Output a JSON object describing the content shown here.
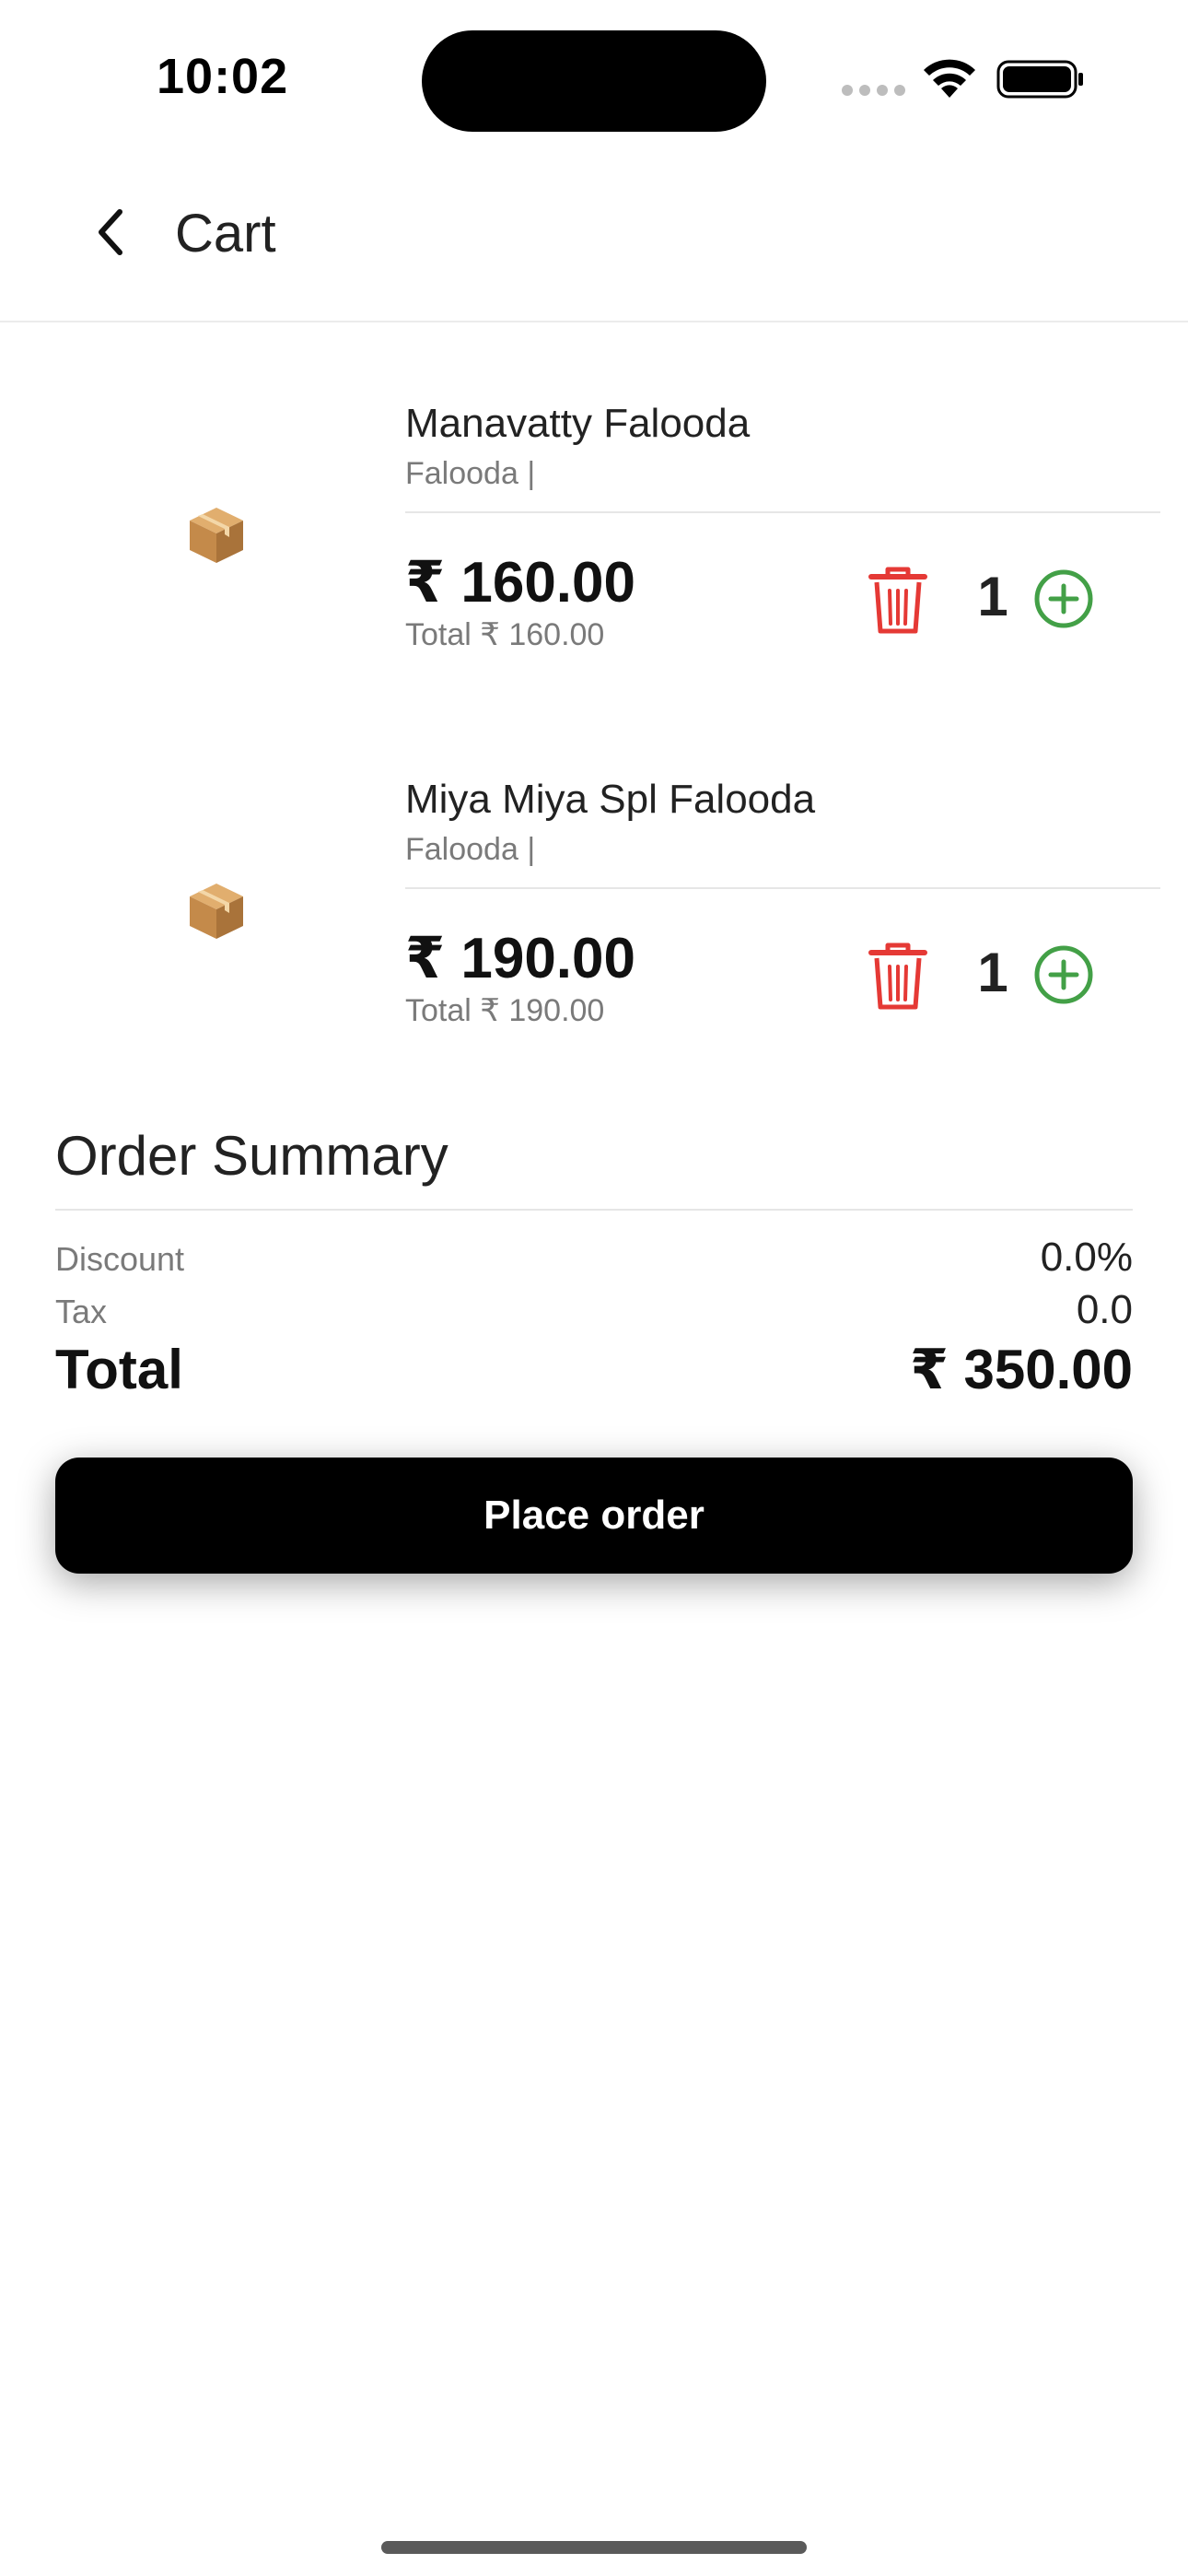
{
  "status_bar": {
    "time": "10:02"
  },
  "header": {
    "title": "Cart",
    "back_icon": "chevron-left-icon"
  },
  "cart": {
    "items": [
      {
        "name": "Manavatty Falooda",
        "category": "Falooda |",
        "price": "₹ 160.00",
        "total": "Total ₹ 160.00",
        "quantity": "1",
        "thumbnail_icon": "package-icon"
      },
      {
        "name": "Miya Miya Spl Falooda",
        "category": "Falooda |",
        "price": "₹ 190.00",
        "total": "Total ₹ 190.00",
        "quantity": "1",
        "thumbnail_icon": "package-icon"
      }
    ]
  },
  "summary": {
    "title": "Order Summary",
    "discount_label": "Discount",
    "discount_value": "0.0%",
    "tax_label": "Tax",
    "tax_value": "0.0",
    "total_label": "Total",
    "total_value": "₹ 350.00"
  },
  "actions": {
    "place_order_label": "Place order"
  },
  "colors": {
    "delete": "#e53935",
    "add": "#43a047",
    "button_bg": "#000000",
    "button_text": "#ffffff"
  }
}
